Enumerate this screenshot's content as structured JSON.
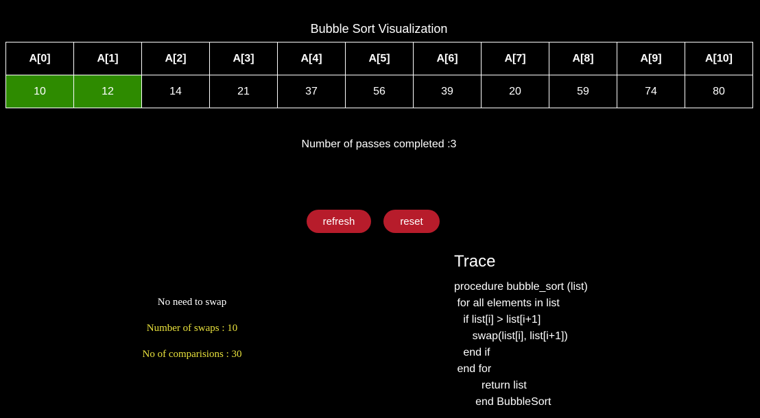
{
  "title": "Bubble Sort Visualization",
  "array": {
    "headers": [
      "A[0]",
      "A[1]",
      "A[2]",
      "A[3]",
      "A[4]",
      "A[5]",
      "A[6]",
      "A[7]",
      "A[8]",
      "A[9]",
      "A[10]"
    ],
    "values": [
      "10",
      "12",
      "14",
      "21",
      "37",
      "56",
      "39",
      "20",
      "59",
      "74",
      "80"
    ],
    "highlight_color": "#2e8b00",
    "highlighted_indices": [
      0,
      1
    ]
  },
  "passes_text": "Number of passes completed :3",
  "buttons": {
    "refresh": "refresh",
    "reset": "reset",
    "color": "#b71c2b"
  },
  "status": {
    "message": "No need to swap",
    "swaps": "Number of swaps : 10",
    "comparisons": "No of comparisions : 30"
  },
  "trace": {
    "heading": "Trace",
    "lines": [
      "procedure bubble_sort (list)",
      " for all elements in list",
      "   if list[i] > list[i+1]",
      "      swap(list[i], list[i+1])",
      "   end if",
      " end for",
      "         return list",
      "       end BubbleSort"
    ]
  }
}
